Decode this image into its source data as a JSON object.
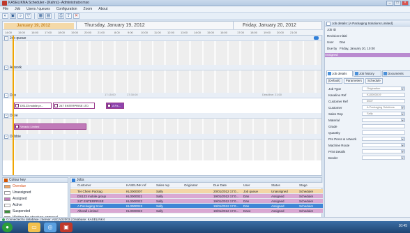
{
  "window": {
    "title": "KASELIKNA Scheduler - [Kahrs] - Administrator.mso"
  },
  "menu": [
    "File",
    "Job",
    "Users / queues",
    "Configuration",
    "Zoom",
    "About"
  ],
  "toolbar_icons": [
    "open-icon",
    "save-icon",
    "search-icon",
    "filter-icon",
    "grid-icon",
    "calendar-icon",
    "print-icon",
    "export-icon",
    "delete-icon"
  ],
  "datebar": {
    "day1": "January 19, 2012",
    "day2": "Thursday, January 19, 2012",
    "day3": "Friday, January 20, 2012",
    "times": [
      "14:00",
      "15:00",
      "16:00",
      "17:00",
      "18:00",
      "19:00",
      "20:00",
      "21:00",
      "8:00",
      "9:00",
      "10:00",
      "11:00",
      "12:00",
      "13:00",
      "14:00",
      "15:00",
      "16:00",
      "17:00",
      "18:00",
      "19:00",
      "20:00",
      "21:00"
    ]
  },
  "gantt": {
    "groups": [
      {
        "label": "Job queue"
      },
      {
        "label": "Artwork"
      },
      {
        "label": "Dan"
      },
      {
        "label": "Dave"
      },
      {
        "label": "Debbie"
      }
    ],
    "tasks": [
      {
        "label": "DS123 mobile pr..."
      },
      {
        "label": "24T ENTERPRISE LTD"
      },
      {
        "label": "A Pa..."
      },
      {
        "label": "Verazio Limited"
      }
    ],
    "annotations": [
      "17:15:00",
      "17:30:00",
      "Deadline: 21:00"
    ]
  },
  "legend": {
    "title": "Colour key",
    "items": [
      {
        "label": "Overdue",
        "color": "#f4a460",
        "text_color": "#d9531e"
      },
      {
        "label": "Unassigned",
        "color": "#ffffff",
        "text_color": "#1c2533"
      },
      {
        "label": "Assigned",
        "color": "#c07ab8",
        "text_color": "#1c2533"
      },
      {
        "label": "Active",
        "color": "#ffffff",
        "text_color": "#1c2533"
      },
      {
        "label": "Suspended",
        "color": "#3a8f3a",
        "text_color": "#1c2533"
      },
      {
        "label": "Waiting for structure approval",
        "color": "#3a8f3a",
        "text_color": "#1c2533"
      },
      {
        "label": "Waiting for artwork",
        "color": "#3a8f3a",
        "text_color": "#1c2533"
      }
    ]
  },
  "jobs": {
    "title": "Jobs",
    "columns": [
      "Customer",
      "KASELINK ref",
      "Sales rep",
      "Originator",
      "Due Date",
      "User",
      "Status",
      "Stage"
    ],
    "rows": [
      {
        "cells": [
          "Ter Chem Packag",
          "KL0000007",
          "Sally",
          "",
          "20/01/2012 17:0...",
          "Job queue",
          "Unassigned",
          "Scheduler"
        ],
        "bg": "#f3d6a6"
      },
      {
        "cells": [
          "DS123 mobile group",
          "KL0000021",
          "Sally",
          "",
          "19/01/2012 17:0...",
          "Dan",
          "Assigned",
          "Scheduler"
        ],
        "bg": "#d9a8d3"
      },
      {
        "cells": [
          "24T ENTERPRISE",
          "KL0000022",
          "Sally",
          "",
          "19/01/2012 17:0...",
          "Dan",
          "Assigned",
          "Scheduler"
        ],
        "bg": "#d9a8d3"
      },
      {
        "cells": [
          "A Packaging Solut",
          "KL0000019",
          "Sally",
          "",
          "19/01/2012 17:0...",
          "Dan",
          "Assigned",
          "Scheduler"
        ],
        "bg": "#3f86d6",
        "fg": "#ffffff"
      },
      {
        "cells": [
          "Afterall Limited",
          "KL0000023",
          "Sally",
          "",
          "19/01/2012 17:0...",
          "Dave",
          "Assigned",
          "Scheduler"
        ],
        "bg": "#d9a8d3"
      }
    ]
  },
  "details": {
    "title": "Job details: [A Packaging Solutions Limited]",
    "summary": [
      {
        "k": "Job ID",
        "v": ""
      },
      {
        "k": "Revision",
        "v": "Initial"
      },
      {
        "k": "User",
        "v": "Dan"
      },
      {
        "k": "Due by",
        "v": "Friday, January 20, 10:00"
      },
      {
        "k": "Assigned",
        "v": ""
      }
    ],
    "tabs": [
      "Job details",
      "Job history",
      "Documents"
    ],
    "subtoolbar": [
      "[Default]",
      "Parameters",
      "Schedule"
    ],
    "fields": [
      {
        "k": "Job Type",
        "v": "Origination",
        "dd": true
      },
      {
        "k": "Kaselino Ref",
        "v": "KL0000019",
        "dd": false
      },
      {
        "k": "Customer Ref",
        "v": "0007",
        "dd": false
      },
      {
        "k": "Customer",
        "v": "A Packaging Solutions",
        "dd": true
      },
      {
        "k": "Sales Rep",
        "v": "Sally",
        "dd": true
      },
      {
        "k": "Material",
        "v": "",
        "dd": true
      },
      {
        "k": "Grade",
        "v": "",
        "dd": false
      },
      {
        "k": "Quantity",
        "v": "",
        "dd": false
      },
      {
        "k": "Pre Press & Artwork",
        "v": "",
        "dd": true
      },
      {
        "k": "Machine Route",
        "v": "",
        "dd": true
      },
      {
        "k": "Print Details",
        "v": "",
        "dd": true
      },
      {
        "k": "Border",
        "v": "",
        "dd": true
      }
    ]
  },
  "status": {
    "text": "Connected to database | Server: ASCAD2003 | Database: KASELINK4"
  },
  "taskbar": {
    "tray": "10:45"
  }
}
